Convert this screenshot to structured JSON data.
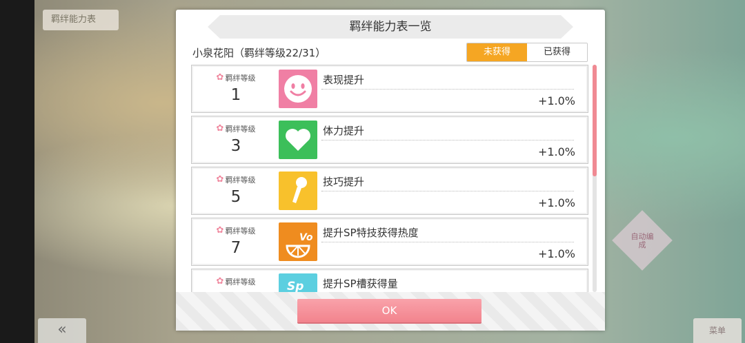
{
  "background": {
    "tag_label": "羁绊能力表",
    "back_label": "«",
    "right_button_label": "菜单",
    "diamond_label": "自动编成"
  },
  "dialog": {
    "title": "羁绊能力表一览",
    "subtitle": "小泉花阳（羁绊等级22/31）",
    "tabs": [
      {
        "label": "未获得",
        "active": true
      },
      {
        "label": "已获得",
        "active": false
      }
    ],
    "level_label": "羁绊等级",
    "rows": [
      {
        "level": "1",
        "name": "表现提升",
        "value": "+1.0%",
        "icon": "smile-icon",
        "color": "#f07fa4"
      },
      {
        "level": "3",
        "name": "体力提升",
        "value": "+1.0%",
        "icon": "heart-icon",
        "color": "#3cbf5a"
      },
      {
        "level": "5",
        "name": "技巧提升",
        "value": "+1.0%",
        "icon": "microphone-icon",
        "color": "#f8c12c"
      },
      {
        "level": "7",
        "name": "提升SP特技获得热度",
        "value": "+1.0%",
        "icon": "vo-icon",
        "color": "#ef8c1f"
      },
      {
        "level": "",
        "name": "提升SP槽获得量",
        "value": "",
        "icon": "sp-icon",
        "color": "#5ccfe0"
      }
    ],
    "ok_label": "OK"
  }
}
